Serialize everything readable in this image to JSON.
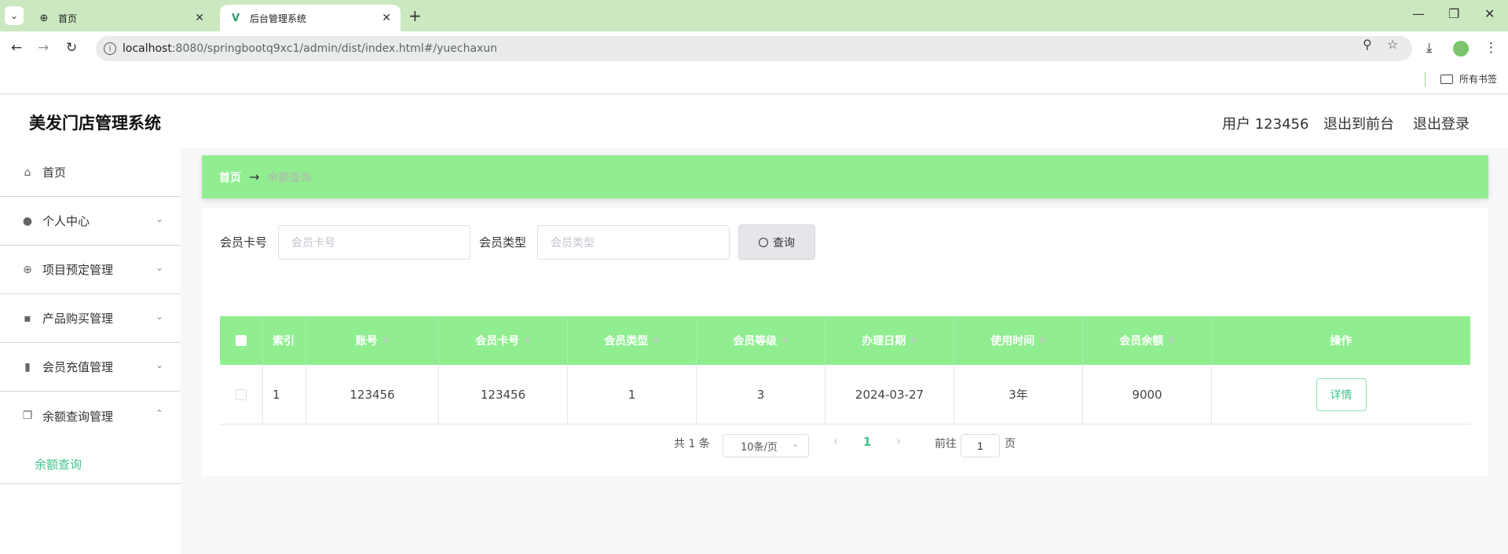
{
  "browser": {
    "tabs": [
      {
        "title": "首页",
        "icon": "globe-icon"
      },
      {
        "title": "后台管理系统",
        "icon": "vue-logo-icon"
      }
    ],
    "url_host": "localhost",
    "url_path": ":8080/springbootq9xc1/admin/dist/index.html#/yuechaxun",
    "bookmarks_folder": "所有书签"
  },
  "header": {
    "title": "美发门店管理系统",
    "user": "用户 123456",
    "to_front": "退出到前台",
    "logout": "退出登录"
  },
  "sidebar": {
    "items": [
      {
        "label": "首页",
        "icon": "home-icon"
      },
      {
        "label": "个人中心",
        "icon": "user-icon"
      },
      {
        "label": "项目预定管理",
        "icon": "target-icon"
      },
      {
        "label": "产品购买管理",
        "icon": "chat-icon"
      },
      {
        "label": "会员充值管理",
        "icon": "library-icon"
      },
      {
        "label": "余额查询管理",
        "icon": "copy-icon"
      }
    ],
    "sub_item": "余额查询"
  },
  "breadcrumb": {
    "home": "首页",
    "arrow": "→",
    "current": "余额查询"
  },
  "search": {
    "card_label": "会员卡号",
    "card_placeholder": "会员卡号",
    "type_label": "会员类型",
    "type_placeholder": "会员类型",
    "button": "查询"
  },
  "table": {
    "headers": [
      "索引",
      "账号",
      "会员卡号",
      "会员类型",
      "会员等级",
      "办理日期",
      "使用时间",
      "会员余额",
      "操作"
    ],
    "rows": [
      {
        "index": "1",
        "account": "123456",
        "card_no": "123456",
        "type": "1",
        "level": "3",
        "date": "2024-03-27",
        "duration": "3年",
        "balance": "9000",
        "action": "详情"
      }
    ]
  },
  "pagination": {
    "total": "共 1 条",
    "page_size": "10条/页",
    "current_page": "1",
    "goto_label": "前往",
    "goto_value": "1",
    "page_suffix": "页"
  },
  "colors": {
    "accent_green": "#90ee90",
    "link_green": "#3ec48a"
  }
}
